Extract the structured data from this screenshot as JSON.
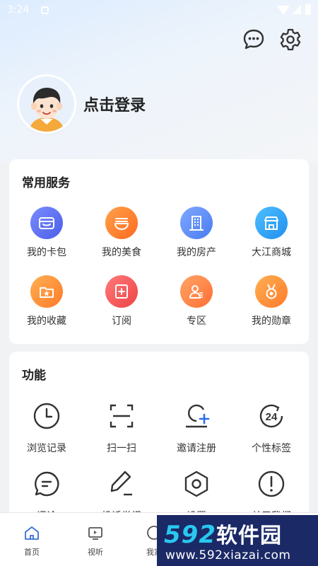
{
  "status_bar": {
    "time": "3:24"
  },
  "header": {
    "login_text": "点击登录"
  },
  "services": {
    "title": "常用服务",
    "items": [
      {
        "label": "我的卡包",
        "icon": "wallet-icon",
        "color": "#5a6ff0"
      },
      {
        "label": "我的美食",
        "icon": "noodle-bowl-icon",
        "color": "#ff7a2e"
      },
      {
        "label": "我的房产",
        "icon": "building-icon",
        "color": "#5a8cf5"
      },
      {
        "label": "大江商城",
        "icon": "storefront-icon",
        "color": "#2a9df4"
      },
      {
        "label": "我的收藏",
        "icon": "favorite-folder-icon",
        "color": "#ff8a3d"
      },
      {
        "label": "订阅",
        "icon": "subscribe-icon",
        "color": "#f25a5a"
      },
      {
        "label": "专区",
        "icon": "user-card-icon",
        "color": "#ff7a3d"
      },
      {
        "label": "我的勋章",
        "icon": "medal-icon",
        "color": "#ff8a3d"
      }
    ]
  },
  "functions": {
    "title": "功能",
    "items": [
      {
        "label": "浏览记录",
        "icon": "clock-icon"
      },
      {
        "label": "扫一扫",
        "icon": "scan-icon"
      },
      {
        "label": "邀请注册",
        "icon": "invite-user-icon"
      },
      {
        "label": "个性标签",
        "icon": "tag-24-icon",
        "badge": "24"
      },
      {
        "label": "评论",
        "icon": "comment-icon"
      },
      {
        "label": "投诉举报",
        "icon": "pen-icon"
      },
      {
        "label": "设置",
        "icon": "hex-nut-icon"
      },
      {
        "label": "关于我们",
        "icon": "info-icon"
      }
    ]
  },
  "tabbar": {
    "items": [
      {
        "label": "首页",
        "icon": "home-icon"
      },
      {
        "label": "视听",
        "icon": "tv-icon"
      },
      {
        "label": "我家",
        "icon": "my-home-icon"
      }
    ]
  },
  "watermark": {
    "brand": "592",
    "brand_zh": "软件园",
    "url": "www.592xiazai.com"
  },
  "colors": {
    "accent": "#2a6ef0",
    "icon_dark": "#333333"
  }
}
